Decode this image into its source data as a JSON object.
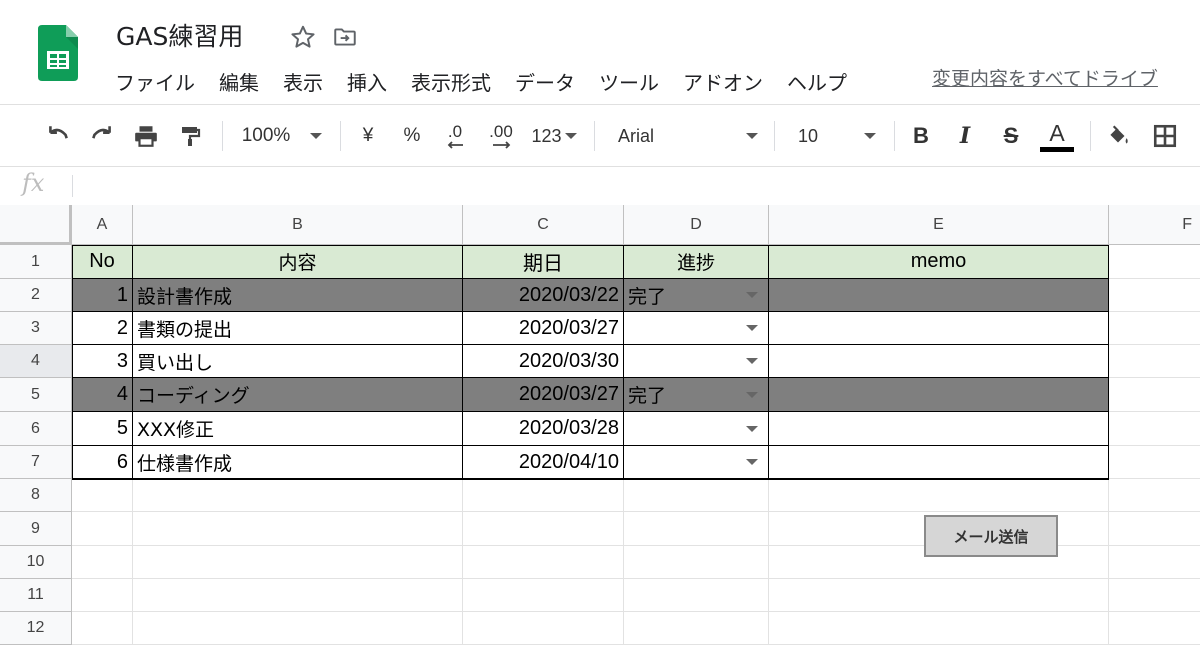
{
  "doc": {
    "title": "GAS練習用",
    "star_icon": "star-icon",
    "move_icon": "move-to-folder-icon",
    "logo_icon": "sheets-logo-icon",
    "logo_color": "#0f9d58"
  },
  "menu": [
    "ファイル",
    "編集",
    "表示",
    "挿入",
    "表示形式",
    "データ",
    "ツール",
    "アドオン",
    "ヘルプ"
  ],
  "save_status": "変更内容をすべてドライブ",
  "toolbar": {
    "zoom": "100%",
    "currency": "¥",
    "percent": "%",
    "decrease_decimal": ".0",
    "increase_decimal": ".00",
    "more_formats": "123",
    "font": "Arial",
    "font_size": "10",
    "bold": "B",
    "italic": "I",
    "strike": "S",
    "text_color": "A",
    "icons": [
      "undo-icon",
      "redo-icon",
      "print-icon",
      "paint-format-icon",
      "fill-color-icon",
      "borders-icon"
    ]
  },
  "formula_bar": {
    "label": "fx",
    "value": ""
  },
  "columns": [
    "A",
    "B",
    "C",
    "D",
    "E",
    "F"
  ],
  "rows": [
    "1",
    "2",
    "3",
    "4",
    "5",
    "6",
    "7",
    "8",
    "9",
    "10",
    "11",
    "12"
  ],
  "table": {
    "headers": [
      "No",
      "内容",
      "期日",
      "進捗",
      "memo"
    ],
    "header_bg": "#d9ead3",
    "done_bg": "#7f7f7f",
    "rows": [
      {
        "no": "1",
        "task": "設計書作成",
        "date": "2020/03/22",
        "status": "完了",
        "memo": "",
        "done": true
      },
      {
        "no": "2",
        "task": "書類の提出",
        "date": "2020/03/27",
        "status": "",
        "memo": "",
        "done": false
      },
      {
        "no": "3",
        "task": "買い出し",
        "date": "2020/03/30",
        "status": "",
        "memo": "",
        "done": false
      },
      {
        "no": "4",
        "task": "コーディング",
        "date": "2020/03/27",
        "status": "完了",
        "memo": "",
        "done": true
      },
      {
        "no": "5",
        "task": "XXX修正",
        "date": "2020/03/28",
        "status": "",
        "memo": "",
        "done": false
      },
      {
        "no": "6",
        "task": "仕様書作成",
        "date": "2020/04/10",
        "status": "",
        "memo": "",
        "done": false
      }
    ]
  },
  "send_button": "メール送信"
}
